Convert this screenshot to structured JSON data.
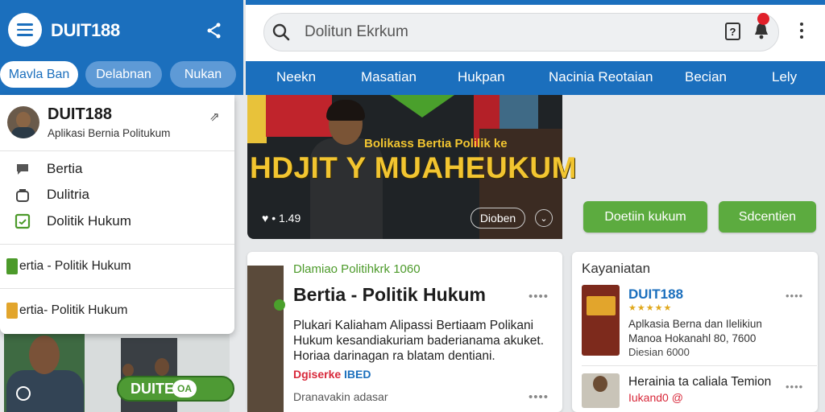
{
  "app": {
    "title": "DUIT188",
    "chips": [
      "Mavla Ban",
      "Delabnan",
      "Nukan"
    ]
  },
  "search": {
    "value": "Dolitun Ekrkum"
  },
  "nav": {
    "tabs": [
      "Neekn",
      "Masatian",
      "Hukpan",
      "Nacinia Reotaian",
      "Becian",
      "Lely"
    ]
  },
  "panel": {
    "name": "DUIT188",
    "subtitle": "Aplikasi Bernia Politukum",
    "menu": [
      {
        "label": "Bertia",
        "icon": "chat-icon"
      },
      {
        "label": "Dulitria",
        "icon": "bag-icon"
      },
      {
        "label": "Dolitik Hukum",
        "icon": "calendar-icon"
      }
    ],
    "sub_items": [
      {
        "label": "ertia - Politik Hukum",
        "icon": "green-doc-icon"
      },
      {
        "label": "ertia- Politik Hukum",
        "icon": "yellow-doc-icon"
      }
    ]
  },
  "hero": {
    "headline_small": "Bolikass Bertia Polilik ke",
    "headline": "HDJIT Y MUAHEUKUM",
    "stats": "• 1.49",
    "button": "Dioben"
  },
  "actions": {
    "primary": "Doetiin kukum",
    "secondary": "Sdcentien"
  },
  "article": {
    "kicker": "Dlamiao Politihkrk 1060",
    "title": "Bertia - Politik Hukum",
    "body": "Plukari Kaliaham Alipassi Bertiaam Polikani Hukum kesandiakuriam baderianama akuket. Horiaa darinagan ra blatam dentiani.",
    "tag_red": "Dgiserke",
    "tag_blue": "IBED",
    "footer": "Dranavakin adasar"
  },
  "side": {
    "title": "Kayaniatan",
    "item1": {
      "name": "DUIT188",
      "stars": "★★★★★",
      "desc": "Aplkasia Berna dan Ilelikiun Manoa Hokanahl 80, 7600",
      "meta": "Diesian 6000"
    },
    "item2": {
      "name": "Herainia ta caliala Temion",
      "meta": "Iukand0 @"
    }
  },
  "photo": {
    "sign": "DUITE",
    "sign_chip": "OA"
  },
  "colors": {
    "brand_blue": "#1b6fbd",
    "accent_green": "#5cab3f",
    "notification_red": "#e0202a",
    "headline_yellow": "#f2c530"
  }
}
